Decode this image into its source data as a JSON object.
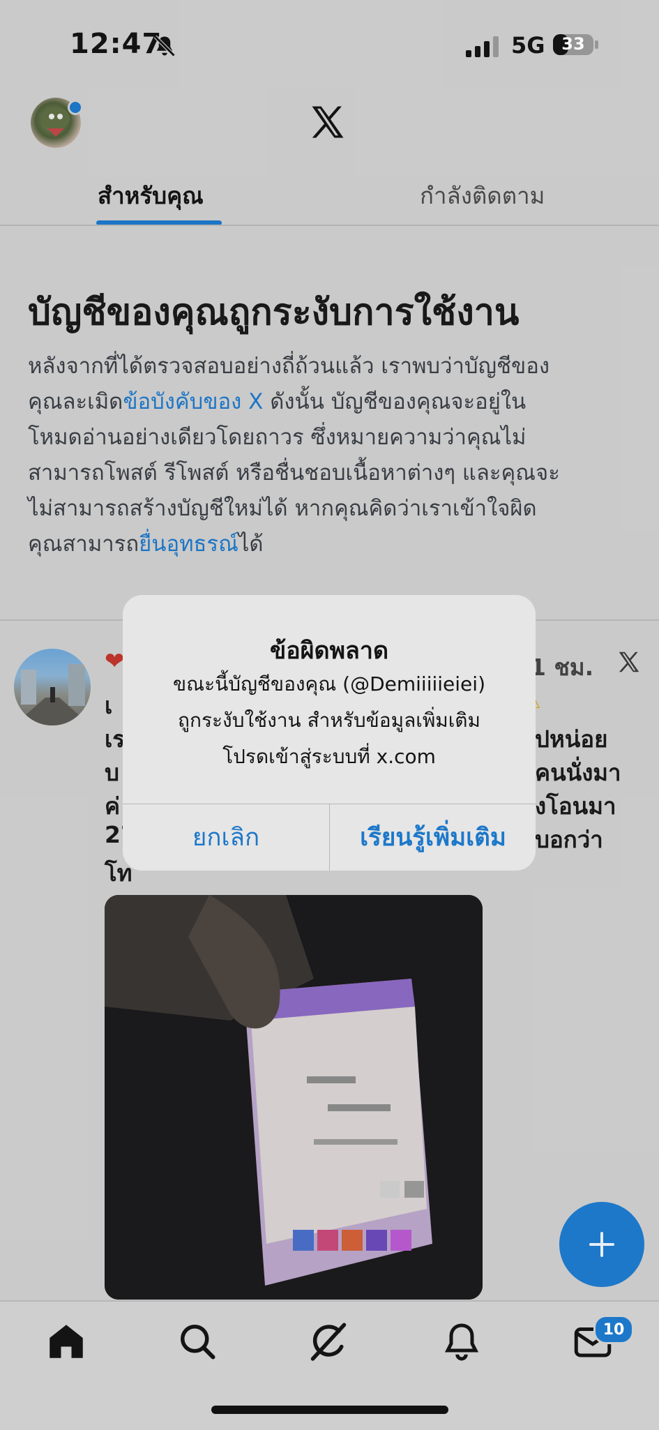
{
  "status_bar": {
    "time": "12:47",
    "network": "5G",
    "battery": "33",
    "icons": [
      "bell-muted-icon",
      "signal-icon",
      "battery-icon"
    ]
  },
  "header": {
    "logo": "X",
    "tabs": [
      {
        "label": "สำหรับคุณ",
        "active": true
      },
      {
        "label": "กำลังติดตาม",
        "active": false
      }
    ]
  },
  "notice": {
    "title": "บัญชีของคุณถูกระงับการใช้งาน",
    "lines": [
      {
        "pre": "หลังจากที่ได้ตรวจสอบอย่างถี่ถ้วนแล้ว เราพบว่าบัญชีของ",
        "link": "",
        "post": ""
      },
      {
        "pre": "คุณละเมิด",
        "link": "ข้อบังคับของ X",
        "post": " ดังนั้น บัญชีของคุณจะอยู่ใน"
      },
      {
        "pre": "โหมดอ่านอย่างเดียวโดยถาวร ซึ่งหมายความว่าคุณไม่",
        "link": "",
        "post": ""
      },
      {
        "pre": "สามารถโพสต์ รีโพสต์ หรือชื่นชอบเนื้อหาต่างๆ และคุณจะ",
        "link": "",
        "post": ""
      },
      {
        "pre": "ไม่สามารถสร้างบัญชีใหม่ได้ หากคุณคิดว่าเราเข้าใจผิด",
        "link": "",
        "post": ""
      },
      {
        "pre": "คุณสามารถ",
        "link": "ยื่นอุทธรณ์",
        "post": "ได้"
      }
    ]
  },
  "post": {
    "time": "1 ชม.",
    "partial_lines": [
      {
        "left": "เ",
        "right": ""
      },
      {
        "left": "เร",
        "right": "ปหน่อย"
      },
      {
        "left": "บ",
        "right": "คนนั่งมา"
      },
      {
        "left": "ค่",
        "right": "งโอนมา"
      },
      {
        "left": "27",
        "right": "บอกว่า"
      },
      {
        "left": "โท",
        "right": ""
      }
    ]
  },
  "dialog": {
    "title": "ข้อผิดพลาด",
    "message_lines": [
      "ขณะนี้บัญชีของคุณ (@Demiiiiieiei)",
      "ถูกระงับใช้งาน สำหรับข้อมูลเพิ่มเติม",
      "โปรดเข้าสู่ระบบที่ x.com"
    ],
    "cancel_label": "ยกเลิก",
    "learn_more_label": "เรียนรู้เพิ่มเติม"
  },
  "compose": {
    "icon": "plus-icon"
  },
  "tab_bar": {
    "items": [
      "home-icon",
      "search-icon",
      "grok-icon",
      "notifications-icon",
      "messages-icon"
    ],
    "messages_badge": "10"
  },
  "colors": {
    "accent": "#1d78c9",
    "background": "#cfcfcf",
    "dialog": "#e6e6e6"
  }
}
